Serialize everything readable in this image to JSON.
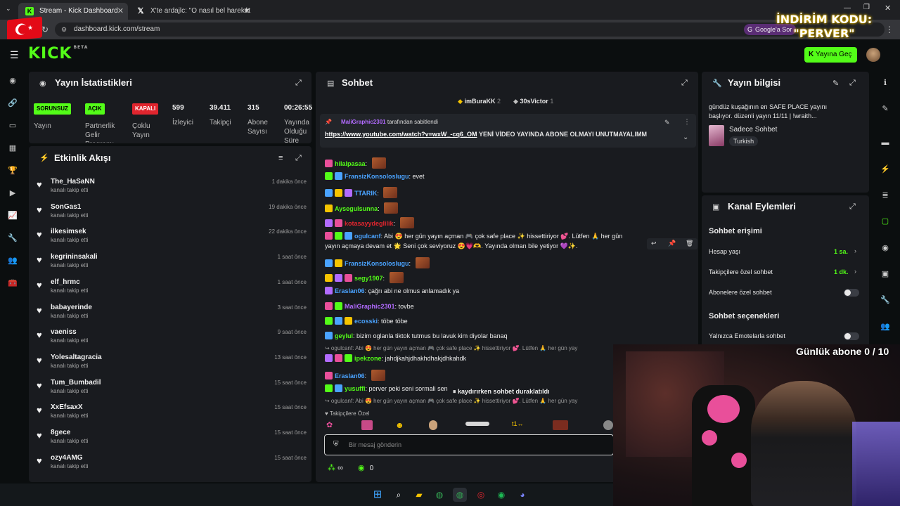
{
  "browser": {
    "tabs": [
      {
        "label": "Stream - Kick Dashboard",
        "active": true
      },
      {
        "label": "X'te ardajlc: \"O nasıl bel hareket",
        "active": false
      }
    ],
    "url": "dashboard.kick.com/stream",
    "google_btn": "Google'a Sor"
  },
  "promo_overlay": "İNDİRİM KODU: \"PERVER\"",
  "header": {
    "logo": "KICK",
    "logo_badge": "BETA",
    "go_live": "Yayına Geç"
  },
  "stats": {
    "title": "Yayın İstatistikleri",
    "badges": [
      {
        "text": "SORUNSUZ",
        "label": "Yayın",
        "color": "#53fc18"
      },
      {
        "text": "AÇIK",
        "label": "Partnerlik Gelir Programı",
        "color": "#53fc18"
      },
      {
        "text": "KAPALI",
        "label": "Çoklu Yayın",
        "color": "#e0252e"
      }
    ],
    "values": [
      {
        "value": "599",
        "label": "İzleyici"
      },
      {
        "value": "39.411",
        "label": "Takipçi"
      },
      {
        "value": "315",
        "label": "Abone Sayısı"
      },
      {
        "value": "00:26:55",
        "label": "Yayında Olduğu Süre"
      }
    ]
  },
  "activity": {
    "title": "Etkinlik Akışı",
    "items": [
      {
        "name": "The_HaSaNN",
        "sub": "kanalı takip etti",
        "time": "1 dakika önce"
      },
      {
        "name": "SonGas1",
        "sub": "kanalı takip etti",
        "time": "19 dakika önce"
      },
      {
        "name": "ilkesimsek",
        "sub": "kanalı takip etti",
        "time": "22 dakika önce"
      },
      {
        "name": "kegrininsakali",
        "sub": "kanalı takip etti",
        "time": "1 saat önce"
      },
      {
        "name": "elf_hrmc",
        "sub": "kanalı takip etti",
        "time": "1 saat önce"
      },
      {
        "name": "babayerinde",
        "sub": "kanalı takip etti",
        "time": "3 saat önce"
      },
      {
        "name": "vaeniss",
        "sub": "kanalı takip etti",
        "time": "9 saat önce"
      },
      {
        "name": "Yolesaltagracia",
        "sub": "kanalı takip etti",
        "time": "13 saat önce"
      },
      {
        "name": "Tum_Bumbadil",
        "sub": "kanalı takip etti",
        "time": "15 saat önce"
      },
      {
        "name": "XxEfsaxX",
        "sub": "kanalı takip etti",
        "time": "15 saat önce"
      },
      {
        "name": "8gece",
        "sub": "kanalı takip etti",
        "time": "15 saat önce"
      },
      {
        "name": "ozy4AMG",
        "sub": "kanalı takip etti",
        "time": "15 saat önce"
      }
    ]
  },
  "chat": {
    "title": "Sohbet",
    "top_gifters": [
      {
        "name": "imBuraKK",
        "count": "2"
      },
      {
        "name": "30sVictor",
        "count": "1"
      }
    ],
    "pinned_by": "MaliGraphic2301",
    "pinned_suffix": "tarafından sabitlendi",
    "pinned_link": "https://www.youtube.com/watch?v=wxW_-cq6_OM",
    "pinned_text": "YENİ VİDEO YAYINDA ABONE OLMAYI UNUTMAYALIMM",
    "messages": [
      {
        "user": "hilalpasaa",
        "color": "#53fc18",
        "text": ""
      },
      {
        "user": "FransizKonsoloslugu",
        "color": "#4aa3ff",
        "text": "evet"
      },
      {
        "user": "TTARIK",
        "color": "#4aa3ff",
        "text": ""
      },
      {
        "user": "Aysegulsunna",
        "color": "#53fc18",
        "text": ""
      },
      {
        "user": "kotasayydeglilik",
        "color": "#e0252e",
        "text": ""
      },
      {
        "user": "ogulcanf",
        "color": "#4aa3ff",
        "text": "Abi 😍 her gün yayın açman 🎮 çok safe place ✨ hissettiriyor 💕. Lütfen 🙏 her gün"
      },
      {
        "user": "",
        "color": "#ececec",
        "text": "yayın açmaya devam et 🌟 Seni çok seviyoruz 😍💗🫶. Yayında olman bile yetiyor 💜✨."
      },
      {
        "user": "FransizKonsoloslugu",
        "color": "#4aa3ff",
        "text": ""
      },
      {
        "user": "segy1907",
        "color": "#53fc18",
        "text": ""
      },
      {
        "user": "Eraslan06",
        "color": "#4aa3ff",
        "text": "çağrı abi ne olmus anlamadık ya"
      },
      {
        "user": "MaliGraphic2301",
        "color": "#b26bff",
        "text": "tovbe"
      },
      {
        "user": "ecosski",
        "color": "#4aa3ff",
        "text": "töbe töbe"
      },
      {
        "user": "geylul",
        "color": "#53fc18",
        "text": "bizim oglanla tiktok tutmus bu lavuk kim diyolar banaq"
      },
      {
        "user": "",
        "color": "#9a9a9a",
        "text": "↪ ogulcanf: Abi 😍 her gün yayın açman 🎮 çok safe place ✨ hissettiriyor 💕. Lütfen 🙏 her gün yay"
      },
      {
        "user": "ipekzone",
        "color": "#53fc18",
        "text": "jahdjkahjdhakhdhakjdhkahdk"
      },
      {
        "user": "Eraslan06",
        "color": "#4aa3ff",
        "text": ""
      },
      {
        "user": "yusuffi",
        "color": "#53fc18",
        "text": "perver peki seni sormali sen"
      },
      {
        "user": "",
        "color": "#9a9a9a",
        "text": "↪ ogulcanf: Abi 😍 her gün yayın açman 🎮 çok safe place ✨ hissettiriyor 💕. Lütfen 🙏 her gün yay"
      }
    ],
    "paused": "kaydırırken sohbet duraklatıldı",
    "followers_only": "Takipçilere Özel",
    "input_placeholder": "Bir mesaj gönderin",
    "infinity": "∞",
    "points": "0"
  },
  "stream_info": {
    "title": "Yayın bilgisi",
    "stream_title": "gündüz kuşağının en SAFE PLACE yayını başlıyor. düzenli yayın 11/11 | !wraith...",
    "category": "Sadece Sohbet",
    "tag": "Turkish"
  },
  "channel_actions": {
    "title": "Kanal Eylemleri",
    "chat_access": "Sohbet erişimi",
    "account_age": {
      "label": "Hesap yaşı",
      "value": "1 sa."
    },
    "followers_only": {
      "label": "Takipçilere özel sohbet",
      "value": "1 dk."
    },
    "subs_only": "Abonelere özel sohbet",
    "chat_options": "Sohbet seçenekleri",
    "emote_only": "Yalnızca Emotelarla sohbet"
  },
  "overlay": {
    "sub_goal": "Günlük abone 0 / 10"
  }
}
